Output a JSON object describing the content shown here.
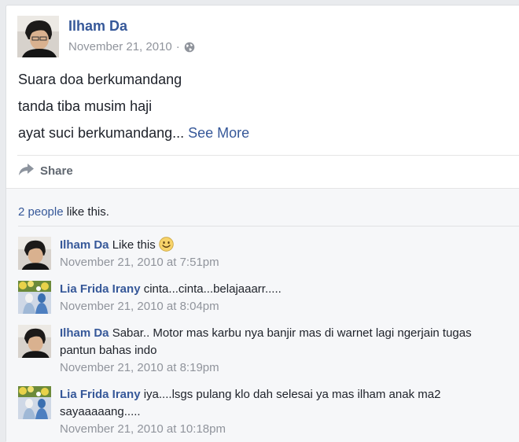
{
  "post": {
    "author": "Ilham Da",
    "timestamp": "November 21, 2010",
    "separator": "·",
    "privacy_icon": "globe-icon",
    "lines": [
      "Suara doa berkumandang",
      "tanda tiba musim haji",
      "ayat suci berkumandang..."
    ],
    "see_more": "See More"
  },
  "actions": {
    "share_label": "Share",
    "share_icon": "share-arrow-icon"
  },
  "likes": {
    "people_link": "2 people",
    "suffix": " like this."
  },
  "comments": [
    {
      "author": "Ilham Da",
      "text": "Like this",
      "emoji": "smiley-icon",
      "time": "November 21, 2010 at 7:51pm"
    },
    {
      "author": "Lia Frida Irany",
      "text": "cinta...cinta...belajaaarr.....",
      "time": "November 21, 2010 at 8:04pm"
    },
    {
      "author": "Ilham Da",
      "text": "Sabar.. Motor mas karbu nya banjir mas di warnet lagi ngerjain tugas pantun bahas indo",
      "time": "November 21, 2010 at 8:19pm"
    },
    {
      "author": "Lia Frida Irany",
      "text": "iya....lsgs pulang klo dah selesai ya mas ilham anak ma2 sayaaaaang.....",
      "time": "November 21, 2010 at 10:18pm"
    }
  ],
  "colors": {
    "link": "#365899",
    "muted": "#90949c",
    "text": "#1d2129",
    "panel": "#f6f7f9"
  }
}
